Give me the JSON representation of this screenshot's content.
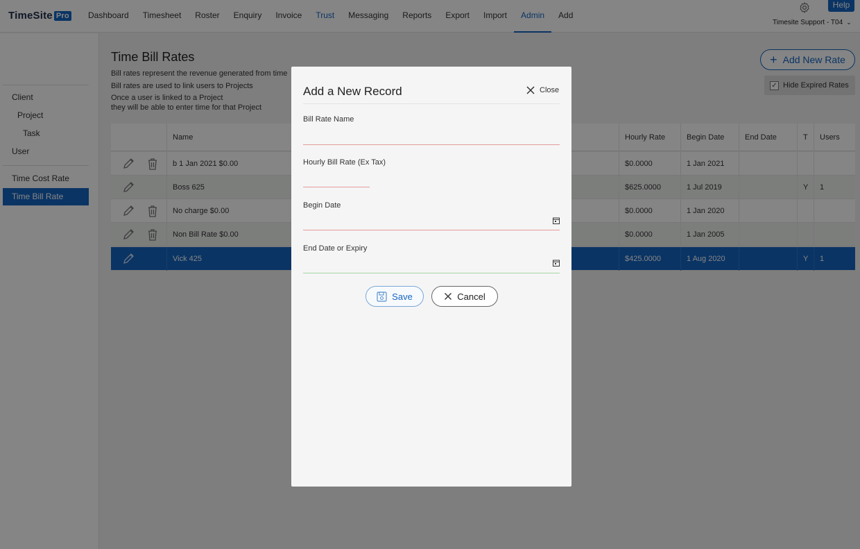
{
  "brand": {
    "name": "TimeSite",
    "badge": "Pro"
  },
  "nav": [
    "Dashboard",
    "Timesheet",
    "Roster",
    "Enquiry",
    "Invoice",
    "Trust",
    "Messaging",
    "Reports",
    "Export",
    "Import",
    "Admin",
    "Add"
  ],
  "header": {
    "help": "Help",
    "user": "Timesite Support - T04"
  },
  "sidebar": [
    "Client",
    "Project",
    "Task",
    "User",
    "Time Cost Rate",
    "Time Bill Rate"
  ],
  "page": {
    "title": "Time Bill Rates",
    "desc": [
      "Bill rates represent the revenue generated from time",
      "Bill rates are used to link users to Projects",
      "Once a user is linked to a Project",
      "they will be able to enter time for that Project"
    ],
    "add_button": "Add New Rate",
    "hide_expired": "Hide Expired Rates",
    "accent": "#1565c0"
  },
  "table": {
    "headers": {
      "name": "Name",
      "hourly": "Hourly Rate",
      "begin": "Begin Date",
      "end": "End Date",
      "t": "T",
      "users": "Users"
    },
    "rows": [
      {
        "name": "b 1 Jan 2021 $0.00",
        "hourly": "$0.0000",
        "begin": "1 Jan 2021",
        "end": "",
        "t": "",
        "users": ""
      },
      {
        "name": "Boss 625",
        "hourly": "$625.0000",
        "begin": "1 Jul 2019",
        "end": "",
        "t": "Y",
        "users": "1"
      },
      {
        "name": "No charge $0.00",
        "hourly": "$0.0000",
        "begin": "1 Jan 2020",
        "end": "",
        "t": "",
        "users": ""
      },
      {
        "name": "Non Bill Rate $0.00",
        "hourly": "$0.0000",
        "begin": "1 Jan 2005",
        "end": "",
        "t": "",
        "users": ""
      },
      {
        "name": "Vick 425",
        "hourly": "$425.0000",
        "begin": "1 Aug 2020",
        "end": "",
        "t": "Y",
        "users": "1"
      }
    ]
  },
  "modal": {
    "title": "Add a New Record",
    "close": "Close",
    "fields": {
      "name_label": "Bill Rate Name",
      "name_value": "",
      "rate_label": "Hourly Bill Rate (Ex Tax)",
      "rate_value": "",
      "begin_label": "Begin Date",
      "begin_value": "",
      "end_label": "End Date or Expiry",
      "end_value": ""
    },
    "save": "Save",
    "cancel": "Cancel"
  }
}
